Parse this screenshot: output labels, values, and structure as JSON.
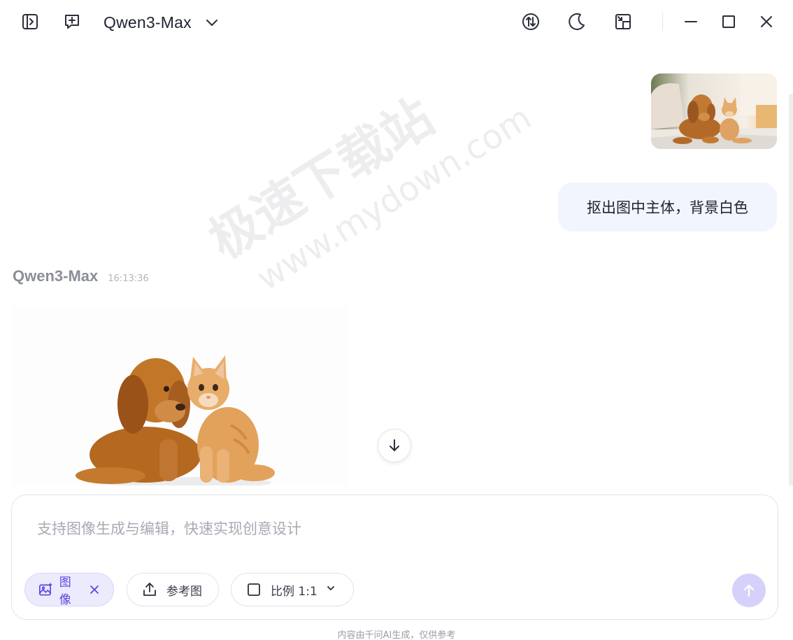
{
  "titlebar": {
    "model_name": "Qwen3-Max",
    "icons": [
      "sidebar-toggle-icon",
      "new-chat-icon",
      "chevron-down-icon",
      "sync-icon",
      "moon-icon",
      "window-snap-icon",
      "minimize-icon",
      "maximize-icon",
      "close-icon"
    ]
  },
  "chat": {
    "user_message": "抠出图中主体，背景白色",
    "bot_name": "Qwen3-Max",
    "bot_time": "16:13:36"
  },
  "watermark": {
    "line1": "极速下载站",
    "line2": "www.mydown.com"
  },
  "composer": {
    "placeholder": "支持图像生成与编辑，快速实现创意设计",
    "image_chip_label": "图像",
    "reference_label": "参考图",
    "ratio_label": "比例 1:1"
  },
  "footer": {
    "disclaimer": "内容由千问AI生成，仅供参考"
  },
  "colors": {
    "accent": "#5a46e0",
    "accent_light": "#ecebfd",
    "send_disabled": "#d6d1fb",
    "user_bubble": "#f2f5fd"
  }
}
